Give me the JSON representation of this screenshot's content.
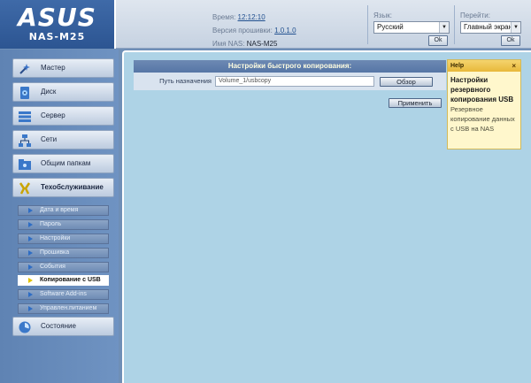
{
  "brand": {
    "logo_text": "ASUS",
    "model": "NAS-M25"
  },
  "info": {
    "time_label": "Время:",
    "time_value": "12:12:10",
    "firmware_label": "Версия прошивки:",
    "firmware_value": "1.0.1.0",
    "nas_label": "Имя NAS:",
    "nas_value": "NAS-M25"
  },
  "language": {
    "label": "Язык:",
    "selected": "Русский",
    "ok_label": "Ok"
  },
  "goto": {
    "label": "Перейти:",
    "selected": "Главный экран",
    "ok_label": "Ok"
  },
  "sidebar": {
    "nav": [
      {
        "label": "Мастер",
        "icon": "wizard-icon"
      },
      {
        "label": "Диск",
        "icon": "disk-icon"
      },
      {
        "label": "Сервер",
        "icon": "server-icon"
      },
      {
        "label": "Сети",
        "icon": "network-icon"
      },
      {
        "label": "Общим папкам",
        "icon": "shared-folders-icon"
      },
      {
        "label": "Техобслуживание",
        "icon": "maintenance-icon"
      },
      {
        "label": "Состояние",
        "icon": "status-icon"
      }
    ],
    "subitems": [
      {
        "label": "Дата и время"
      },
      {
        "label": "Пароль"
      },
      {
        "label": "Настройки"
      },
      {
        "label": "Прошивка"
      },
      {
        "label": "События"
      },
      {
        "label": "Копирование с USB"
      },
      {
        "label": "Software Add-ins"
      },
      {
        "label": "Управлен.питанием"
      }
    ]
  },
  "main": {
    "panel_title": "Настройки быстрого копирования:",
    "dest_label": "Путь назначения",
    "dest_value": "Volume_1/usbcopy",
    "browse_label": "Обзор",
    "apply_label": "Применить"
  },
  "help": {
    "header": "Help",
    "close": "×",
    "title": "Настройки резервного копирования USB",
    "body": "Резервное копирование данных с USB на NAS"
  },
  "colors": {
    "main_bg": "#aed3e6",
    "sidebar_bg": "#6f93c2",
    "panel_title_bg": "#5676a6",
    "help_bg": "#fff7cc"
  }
}
